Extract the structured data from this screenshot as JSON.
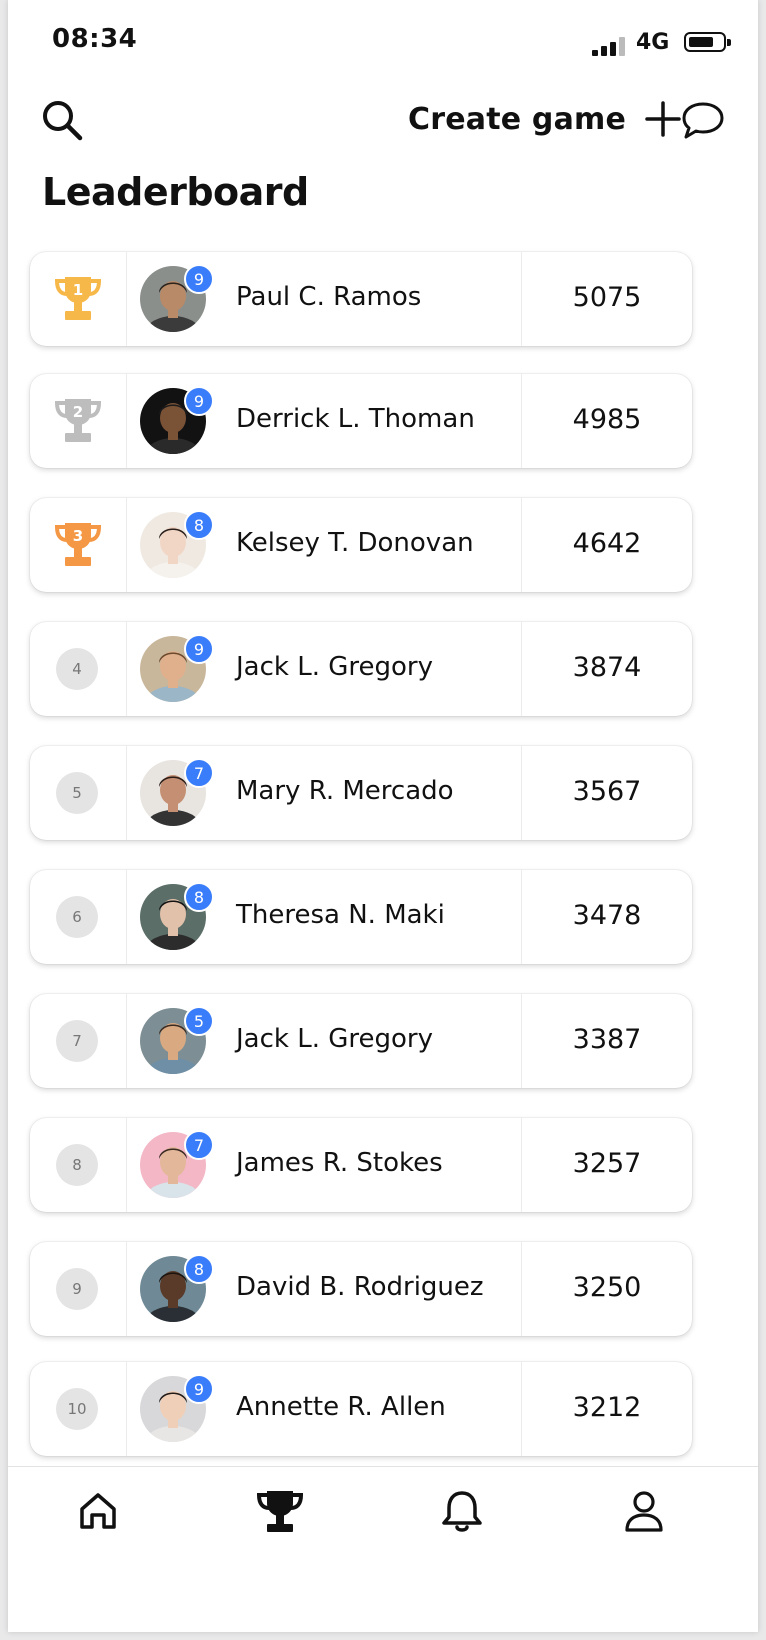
{
  "status_bar": {
    "time": "08:34",
    "network": "4G"
  },
  "toolbar": {
    "create_label": "Create game"
  },
  "page": {
    "title": "Leaderboard"
  },
  "players": [
    {
      "rank": "1",
      "name": "Paul C. Ramos",
      "score": "5075",
      "badge": "9",
      "trophy": "gold",
      "avatar": {
        "bg": "#8a8f8c",
        "skin": "#b98a68",
        "hair": "#2a221d",
        "shirt": "#3b3b3b"
      }
    },
    {
      "rank": "2",
      "name": "Derrick L. Thoman",
      "score": "4985",
      "badge": "9",
      "trophy": "silver",
      "avatar": {
        "bg": "#121212",
        "skin": "#7a5236",
        "hair": "#1c1c1c",
        "shirt": "#2a2a2a"
      }
    },
    {
      "rank": "3",
      "name": "Kelsey T. Donovan",
      "score": "4642",
      "badge": "8",
      "trophy": "bronze",
      "avatar": {
        "bg": "#efe9e2",
        "skin": "#f1d6c5",
        "hair": "#2b1f1b",
        "shirt": "#f5f2ee"
      }
    },
    {
      "rank": "4",
      "name": "Jack L. Gregory",
      "score": "3874",
      "badge": "9",
      "avatar": {
        "bg": "#c9b79c",
        "skin": "#e0b08d",
        "hair": "#6b4a2d",
        "shirt": "#9bb6c6"
      }
    },
    {
      "rank": "5",
      "name": "Mary R. Mercado",
      "score": "3567",
      "badge": "7",
      "avatar": {
        "bg": "#e8e4e0",
        "skin": "#c48f72",
        "hair": "#2b1c17",
        "shirt": "#333333"
      }
    },
    {
      "rank": "6",
      "name": "Theresa N. Maki",
      "score": "3478",
      "badge": "8",
      "avatar": {
        "bg": "#5b6e68",
        "skin": "#e2c1ab",
        "hair": "#141414",
        "shirt": "#2c2c2c"
      }
    },
    {
      "rank": "7",
      "name": "Jack L. Gregory",
      "score": "3387",
      "badge": "5",
      "avatar": {
        "bg": "#7d8f94",
        "skin": "#d9a982",
        "hair": "#3b2c22",
        "shirt": "#6f8fa6"
      }
    },
    {
      "rank": "8",
      "name": "James R. Stokes",
      "score": "3257",
      "badge": "7",
      "avatar": {
        "bg": "#f3b7c6",
        "skin": "#e3b79a",
        "hair": "#3a2b22",
        "shirt": "#d8e3ea"
      }
    },
    {
      "rank": "9",
      "name": "David B. Rodriguez",
      "score": "3250",
      "badge": "8",
      "avatar": {
        "bg": "#6f8a96",
        "skin": "#5a3a28",
        "hair": "#1a1410",
        "shirt": "#2a2f35"
      }
    },
    {
      "rank": "10",
      "name": "Annette R. Allen",
      "score": "3212",
      "badge": "9",
      "avatar": {
        "bg": "#d8d8da",
        "skin": "#efcfb8",
        "hair": "#1f1a18",
        "shirt": "#e8e6e4"
      }
    }
  ],
  "colors": {
    "badge": "#3a7dfa",
    "gold": "#f7b84a",
    "silver": "#bdbdbd",
    "bronze": "#f49845"
  },
  "tabs": [
    {
      "id": "home",
      "icon": "home-icon",
      "active": false
    },
    {
      "id": "leaderboard",
      "icon": "trophy-icon",
      "active": true
    },
    {
      "id": "notifications",
      "icon": "bell-icon",
      "active": false
    },
    {
      "id": "profile",
      "icon": "user-icon",
      "active": false
    }
  ]
}
